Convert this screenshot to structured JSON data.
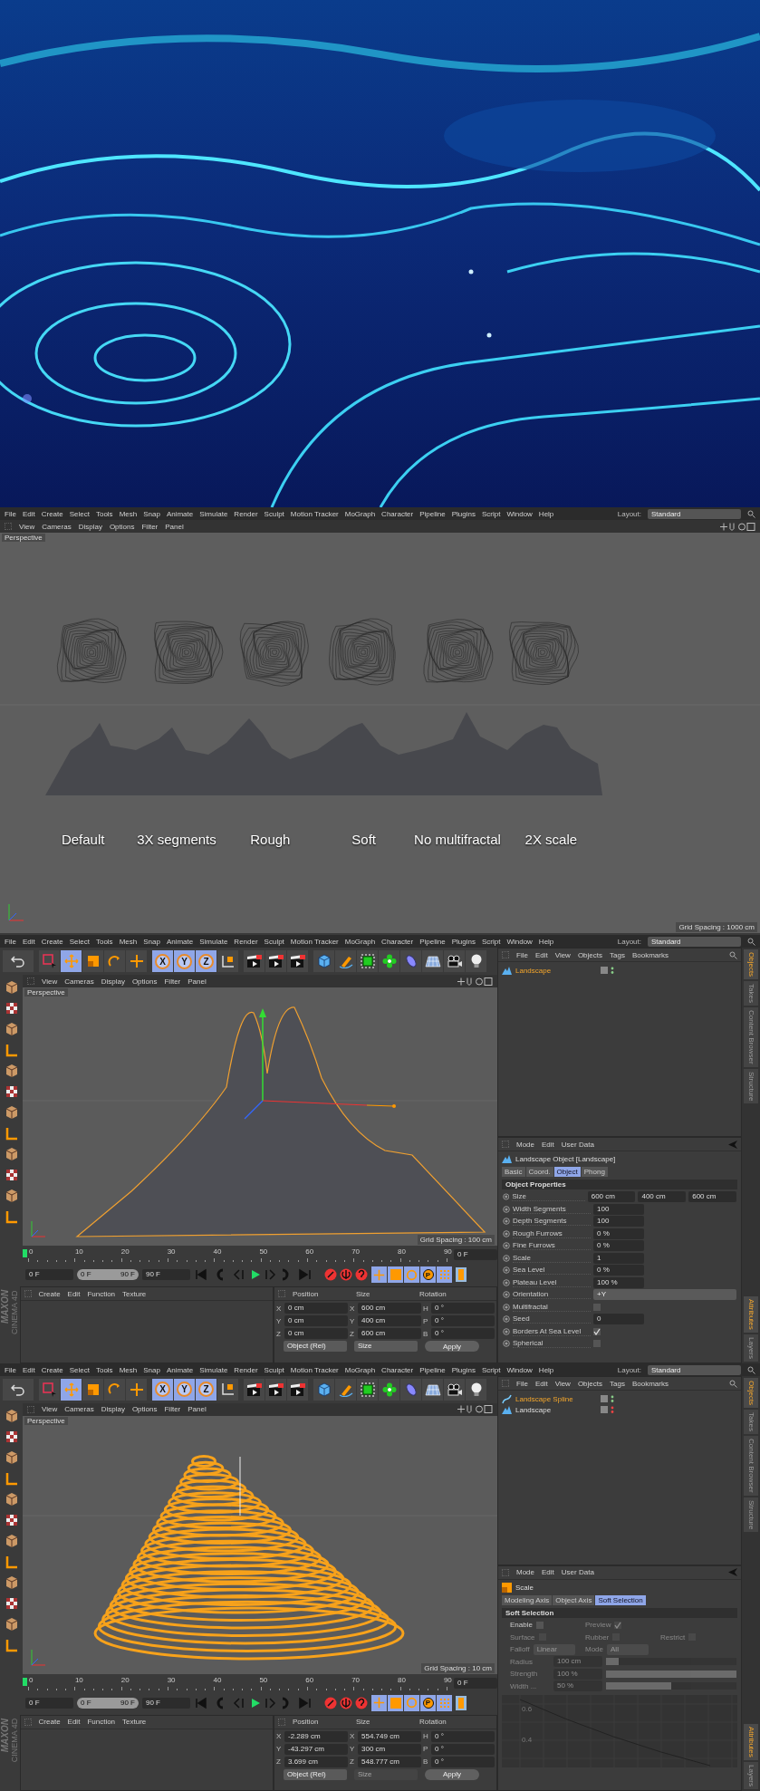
{
  "screens": [
    {
      "kind": "viewport",
      "menu": [
        "File",
        "Edit",
        "Create",
        "Select",
        "Tools",
        "Mesh",
        "Snap",
        "Animate",
        "Simulate",
        "Render",
        "Sculpt",
        "Motion Tracker",
        "MoGraph",
        "Character",
        "Pipeline",
        "Plugins",
        "Script",
        "Window",
        "Help"
      ],
      "layout": {
        "label": "Layout:",
        "value": "Standard"
      },
      "view_menu": [
        "View",
        "Cameras",
        "Display",
        "Options",
        "Filter",
        "Panel"
      ],
      "viewport": {
        "label": "Perspective",
        "captions": [
          "Default",
          "3X segments",
          "Rough",
          "Soft",
          "No multifractal",
          "2X scale"
        ],
        "grid_spacing": "Grid Spacing : 1000 cm"
      }
    },
    {
      "kind": "workspace",
      "menu": [
        "File",
        "Edit",
        "Create",
        "Select",
        "Tools",
        "Mesh",
        "Snap",
        "Animate",
        "Simulate",
        "Render",
        "Sculpt",
        "Motion Tracker",
        "MoGraph",
        "Character",
        "Pipeline",
        "Plugins",
        "Script",
        "Window",
        "Help"
      ],
      "layout": {
        "label": "Layout:",
        "value": "Standard"
      },
      "toolbar": {
        "tools": [
          {
            "kind": "undo",
            "selected": false
          },
          {
            "kind": "select",
            "selected": false
          },
          {
            "kind": "move",
            "selected": true
          },
          {
            "kind": "scale",
            "selected": false
          },
          {
            "kind": "rotate",
            "selected": false
          },
          {
            "kind": "add",
            "selected": false
          },
          {
            "kind": "axis",
            "label": "X",
            "selected": true
          },
          {
            "kind": "axis",
            "label": "Y",
            "selected": true
          },
          {
            "kind": "axis",
            "label": "Z",
            "selected": true
          },
          {
            "kind": "coords",
            "selected": false
          },
          {
            "kind": "render",
            "selected": false
          },
          {
            "kind": "render",
            "selected": false
          },
          {
            "kind": "render",
            "selected": false
          },
          {
            "kind": "cube",
            "selected": false
          },
          {
            "kind": "pen",
            "selected": false
          },
          {
            "kind": "subdivision",
            "selected": false
          },
          {
            "kind": "cloner",
            "selected": false
          },
          {
            "kind": "deformer",
            "selected": false
          },
          {
            "kind": "floor",
            "selected": false
          },
          {
            "kind": "camera",
            "selected": false
          },
          {
            "kind": "light",
            "selected": false
          }
        ]
      },
      "view_menu": [
        "View",
        "Cameras",
        "Display",
        "Options",
        "Filter",
        "Panel"
      ],
      "viewport": {
        "label": "Perspective",
        "grid_spacing": "Grid Spacing : 100 cm"
      },
      "timeline": {
        "ticks": [
          "0",
          "10",
          "20",
          "30",
          "40",
          "50",
          "60",
          "70",
          "80",
          "90"
        ],
        "current": "0 F",
        "start": "0 F",
        "range": {
          "start": "0 F",
          "end": "90 F",
          "level": 1
        },
        "end": "90 F",
        "key_buttons": [
          {
            "kind": "move",
            "on": true
          },
          {
            "kind": "scale",
            "on": true
          },
          {
            "kind": "rotate",
            "on": true
          },
          {
            "kind": "param",
            "label": "P",
            "on": true
          },
          {
            "kind": "points",
            "on": true
          }
        ]
      },
      "logo": [
        "MAXON",
        "CINEMA 4D"
      ],
      "materials": {
        "menu": [
          "Create",
          "Edit",
          "Function",
          "Texture"
        ]
      },
      "coordinates": {
        "headers": [
          "Position",
          "Size",
          "Rotation"
        ],
        "rows": [
          {
            "cells": [
              {
                "axis": "X",
                "value": "0 cm"
              },
              {
                "axis": "X",
                "value": "600 cm"
              },
              {
                "axis": "H",
                "value": "0 °"
              }
            ]
          },
          {
            "cells": [
              {
                "axis": "Y",
                "value": "0 cm"
              },
              {
                "axis": "Y",
                "value": "400 cm"
              },
              {
                "axis": "P",
                "value": "0 °"
              }
            ]
          },
          {
            "cells": [
              {
                "axis": "Z",
                "value": "0 cm"
              },
              {
                "axis": "Z",
                "value": "600 cm"
              },
              {
                "axis": "B",
                "value": "0 °"
              }
            ]
          }
        ],
        "mode": "Object (Rel)",
        "size_mode": {
          "value": "Size",
          "disabled": false
        },
        "apply": "Apply"
      },
      "objects": {
        "menu": [
          "File",
          "Edit",
          "View",
          "Objects",
          "Tags",
          "Bookmarks"
        ],
        "items": [
          {
            "name": "Landscape",
            "kind": "landscape",
            "selected": true
          }
        ]
      },
      "attributes": {
        "menu": [
          "Mode",
          "Edit",
          "User Data"
        ],
        "title": "Landscape Object [Landscape]",
        "tabs": [
          {
            "label": "Basic",
            "selected": false
          },
          {
            "label": "Coord.",
            "selected": false
          },
          {
            "label": "Object",
            "selected": true
          },
          {
            "label": "Phong",
            "selected": false
          }
        ],
        "section": "Object Properties",
        "rows": [
          {
            "kind": "fields",
            "label": "Size",
            "values": [
              "600 cm",
              "400 cm",
              "600 cm"
            ]
          },
          {
            "kind": "number",
            "label": "Width Segments",
            "value": "100"
          },
          {
            "kind": "number",
            "label": "Depth Segments",
            "value": "100"
          },
          {
            "kind": "number",
            "label": "Rough Furrows",
            "value": "0 %"
          },
          {
            "kind": "number",
            "label": "Fine Furrows",
            "value": "0 %"
          },
          {
            "kind": "number",
            "label": "Scale",
            "value": "1"
          },
          {
            "kind": "number",
            "label": "Sea Level",
            "value": "0 %"
          },
          {
            "kind": "number",
            "label": "Plateau Level",
            "value": "100 %"
          },
          {
            "kind": "dropdown",
            "label": "Orientation",
            "value": "+Y"
          },
          {
            "kind": "checkbox",
            "label": "Multifractal",
            "checked": false
          },
          {
            "kind": "number",
            "label": "Seed",
            "value": "0"
          },
          {
            "kind": "checkbox",
            "label": "Borders At Sea Level",
            "checked": true
          },
          {
            "kind": "checkbox",
            "label": "Spherical",
            "checked": false
          }
        ]
      },
      "side_tabs": {
        "top": [
          {
            "label": "Objects",
            "selected": true
          },
          {
            "label": "Takes",
            "selected": false
          },
          {
            "label": "Content Browser",
            "selected": false
          },
          {
            "label": "Structure",
            "selected": false
          }
        ],
        "bottom": [
          {
            "label": "Attributes",
            "selected": true
          },
          {
            "label": "Layers",
            "selected": false
          }
        ]
      }
    },
    {
      "kind": "workspace",
      "menu": [
        "File",
        "Edit",
        "Create",
        "Select",
        "Tools",
        "Mesh",
        "Snap",
        "Animate",
        "Simulate",
        "Render",
        "Sculpt",
        "Motion Tracker",
        "MoGraph",
        "Character",
        "Pipeline",
        "Plugins",
        "Script",
        "Window",
        "Help"
      ],
      "layout": {
        "label": "Layout:",
        "value": "Standard"
      },
      "toolbar": {
        "tools": [
          {
            "kind": "undo",
            "selected": false
          },
          {
            "kind": "select",
            "selected": false
          },
          {
            "kind": "move",
            "selected": true
          },
          {
            "kind": "scale",
            "selected": false
          },
          {
            "kind": "rotate",
            "selected": false
          },
          {
            "kind": "add",
            "selected": false
          },
          {
            "kind": "axis",
            "label": "X",
            "selected": true
          },
          {
            "kind": "axis",
            "label": "Y",
            "selected": true
          },
          {
            "kind": "axis",
            "label": "Z",
            "selected": true
          },
          {
            "kind": "coords",
            "selected": false
          },
          {
            "kind": "render",
            "selected": false
          },
          {
            "kind": "render",
            "selected": false
          },
          {
            "kind": "render",
            "selected": false
          },
          {
            "kind": "cube",
            "selected": false
          },
          {
            "kind": "pen",
            "selected": false
          },
          {
            "kind": "subdivision",
            "selected": false
          },
          {
            "kind": "cloner",
            "selected": false
          },
          {
            "kind": "deformer",
            "selected": false
          },
          {
            "kind": "floor",
            "selected": false
          },
          {
            "kind": "camera",
            "selected": false
          },
          {
            "kind": "light",
            "selected": false
          }
        ]
      },
      "view_menu": [
        "View",
        "Cameras",
        "Display",
        "Options",
        "Filter",
        "Panel"
      ],
      "viewport": {
        "label": "Perspective",
        "grid_spacing": "Grid Spacing : 10 cm"
      },
      "timeline": {
        "ticks": [
          "0",
          "10",
          "20",
          "30",
          "40",
          "50",
          "60",
          "70",
          "80",
          "90"
        ],
        "current": "0 F",
        "start": "0 F",
        "range": {
          "start": "0 F",
          "end": "90 F",
          "level": 1
        },
        "end": "90 F",
        "key_buttons": [
          {
            "kind": "move",
            "on": true
          },
          {
            "kind": "scale",
            "on": true
          },
          {
            "kind": "rotate",
            "on": true
          },
          {
            "kind": "param",
            "label": "P",
            "on": true
          },
          {
            "kind": "points",
            "on": true
          }
        ]
      },
      "logo": [
        "MAXON",
        "CINEMA 4D"
      ],
      "materials": {
        "menu": [
          "Create",
          "Edit",
          "Function",
          "Texture"
        ]
      },
      "coordinates": {
        "headers": [
          "Position",
          "Size",
          "Rotation"
        ],
        "rows": [
          {
            "cells": [
              {
                "axis": "X",
                "value": "-2.289 cm"
              },
              {
                "axis": "X",
                "value": "554.749 cm"
              },
              {
                "axis": "H",
                "value": "0 °"
              }
            ]
          },
          {
            "cells": [
              {
                "axis": "Y",
                "value": "-43.297 cm"
              },
              {
                "axis": "Y",
                "value": "300 cm"
              },
              {
                "axis": "P",
                "value": "0 °"
              }
            ]
          },
          {
            "cells": [
              {
                "axis": "Z",
                "value": "3.699 cm"
              },
              {
                "axis": "Z",
                "value": "548.777 cm"
              },
              {
                "axis": "B",
                "value": "0 °"
              }
            ]
          }
        ],
        "mode": "Object (Rel)",
        "size_mode": {
          "value": "Size",
          "disabled": true
        },
        "apply": "Apply"
      },
      "objects": {
        "menu": [
          "File",
          "Edit",
          "View",
          "Objects",
          "Tags",
          "Bookmarks"
        ],
        "items": [
          {
            "name": "Landscape Spline",
            "kind": "spline",
            "selected": true
          },
          {
            "name": "Landscape",
            "kind": "landscape",
            "selected": false
          }
        ]
      },
      "attributes": {
        "menu": [
          "Mode",
          "Edit",
          "User Data"
        ],
        "title": "Scale",
        "tabs": [
          {
            "label": "Modeling Axis",
            "selected": false
          },
          {
            "label": "Object Axis",
            "selected": false
          },
          {
            "label": "Soft Selection",
            "selected": true
          }
        ],
        "section": "Soft Selection",
        "rows": [
          {
            "kind": "inline",
            "items": [
              {
                "kind": "checkbox",
                "label": "Enable",
                "checked": false,
                "disabled": false
              },
              {
                "kind": "checkbox",
                "label": "Preview",
                "checked": true,
                "disabled": true
              }
            ]
          },
          {
            "kind": "inline",
            "items": [
              {
                "kind": "checkbox",
                "label": "Surface",
                "checked": false,
                "disabled": true
              },
              {
                "kind": "checkbox",
                "label": "Rubber",
                "checked": false,
                "disabled": true
              },
              {
                "kind": "checkbox",
                "label": "Restrict",
                "checked": false,
                "disabled": true
              }
            ]
          },
          {
            "kind": "inline",
            "items": [
              {
                "kind": "dropdown",
                "label": "Falloff",
                "value": "Linear",
                "disabled": true
              },
              {
                "kind": "dropdown",
                "label": "Mode",
                "value": "All",
                "disabled": true
              }
            ]
          },
          {
            "kind": "slider",
            "label": "Radius",
            "value": "100 cm",
            "level": 0.1,
            "disabled": true
          },
          {
            "kind": "slider",
            "label": "Strength",
            "value": "100 %",
            "level": 1,
            "disabled": true
          },
          {
            "kind": "slider",
            "label": "Width ...",
            "value": "50 %",
            "level": 0.5,
            "disabled": true
          },
          {
            "kind": "graph",
            "labels": [
              "0.6",
              "0.4"
            ]
          }
        ]
      },
      "side_tabs": {
        "top": [
          {
            "label": "Objects",
            "selected": true
          },
          {
            "label": "Takes",
            "selected": false
          },
          {
            "label": "Content Browser",
            "selected": false
          },
          {
            "label": "Structure",
            "selected": false
          }
        ],
        "bottom": [
          {
            "label": "Attributes",
            "selected": true
          },
          {
            "label": "Layers",
            "selected": false
          }
        ]
      }
    }
  ]
}
